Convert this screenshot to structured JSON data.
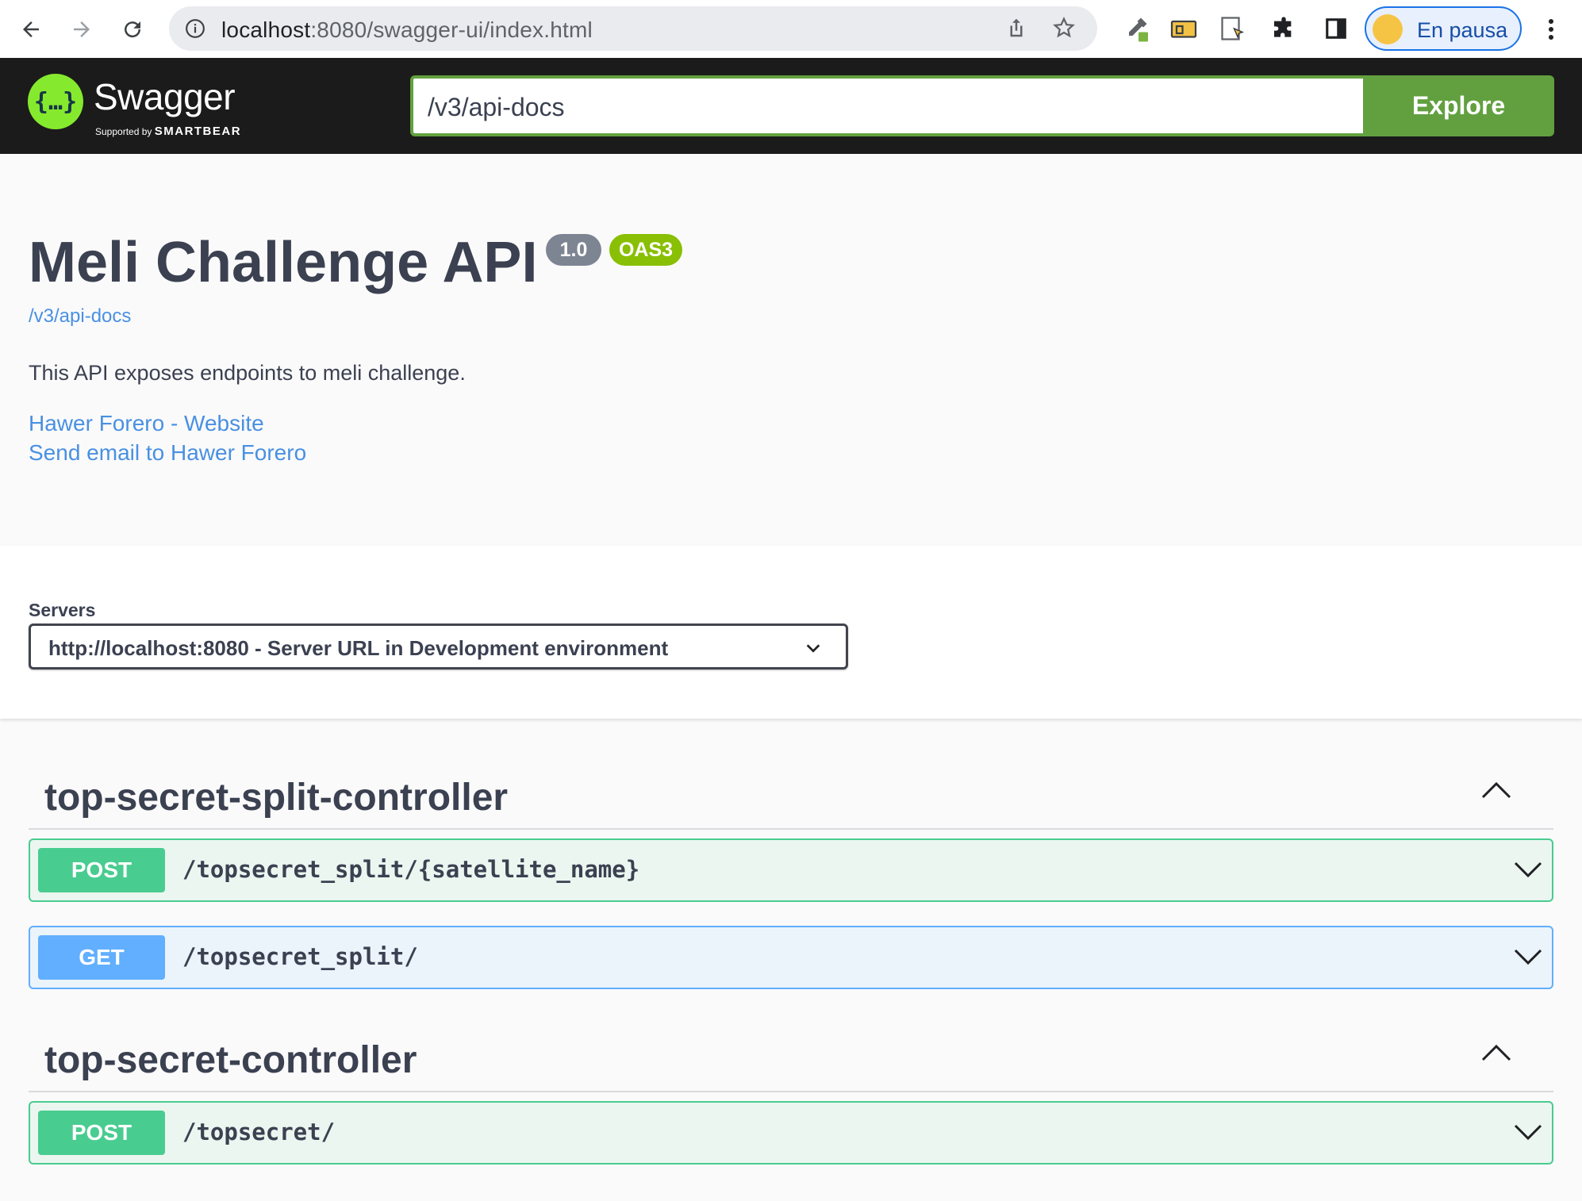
{
  "browser": {
    "url_host": "localhost",
    "url_rest": ":8080/swagger-ui/index.html",
    "profile_label": "En pausa"
  },
  "topbar": {
    "logo_text": "Swagger",
    "logo_sub_prefix": "Supported by",
    "logo_sub_brand": "SMARTBEAR",
    "spec_url": "/v3/api-docs",
    "explore_label": "Explore"
  },
  "info": {
    "title": "Meli Challenge API",
    "version": "1.0",
    "oas": "OAS3",
    "spec_link": "/v3/api-docs",
    "description": "This API exposes endpoints to meli challenge.",
    "website_link": "Hawer Forero - Website",
    "email_link": "Send email to Hawer Forero"
  },
  "servers": {
    "label": "Servers",
    "selected": "http://localhost:8080 - Server URL in Development environment"
  },
  "tags": [
    {
      "name": "top-secret-split-controller",
      "operations": [
        {
          "method": "POST",
          "path": "/topsecret_split/{satellite_name}"
        },
        {
          "method": "GET",
          "path": "/topsecret_split/"
        }
      ]
    },
    {
      "name": "top-secret-controller",
      "operations": [
        {
          "method": "POST",
          "path": "/topsecret/"
        }
      ]
    }
  ]
}
